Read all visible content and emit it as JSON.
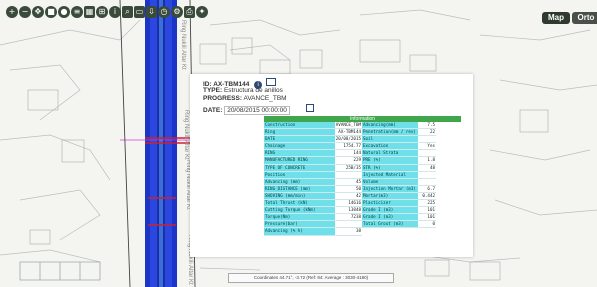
{
  "map": {
    "street_labels": [
      "Ring Nukili Altar Kt",
      "Ring Nukili Altar Kt",
      "Ring Nukili Altar Kt",
      "Ring Nukili Altar Kt"
    ],
    "toggles": {
      "map": "Map",
      "orto": "Orto"
    },
    "colors": {
      "accent": "#2d3a2d",
      "track_blue": "#1b35c7",
      "track_red": "#cc2233",
      "info_green": "#3fa64b",
      "label_cyan": "#6fe0ea"
    }
  },
  "toolbar": {
    "icons": [
      "zoom-in-icon",
      "zoom-out-icon",
      "pan-icon",
      "stop-icon",
      "record-icon",
      "layers-icon",
      "grid-icon",
      "measure-icon",
      "info-icon",
      "search-icon",
      "select-icon",
      "export-icon",
      "clock-icon",
      "settings-icon",
      "print-icon",
      "marker-icon"
    ]
  },
  "popup": {
    "id": "ID: AX-TBM144",
    "type_label": "TYPE:",
    "type_value": "Estructura de anillos",
    "progress_label": "PROGRESS:",
    "progress_value": "AVANCE_TBM",
    "date_label": "DATE:",
    "date_value": "20/08/2015 00:00:00",
    "info_title": "Information",
    "left_rows": [
      {
        "k": "Construction",
        "v": "AVANCE_TBM"
      },
      {
        "k": "Ring",
        "v": "AX-TBM144"
      },
      {
        "k": "DATE",
        "v": "20/08/2015"
      },
      {
        "k": "Chainage",
        "v": "1754.77"
      },
      {
        "k": "RING",
        "v": "144"
      },
      {
        "k": "MANUFACTURED RING",
        "v": "229"
      },
      {
        "k": "TYPE OF CONCRETE",
        "v": "25B/35"
      },
      {
        "k": "Position",
        "v": ""
      },
      {
        "k": "Advancing (mm)",
        "v": "45"
      },
      {
        "k": "RING DISTANCE (mm)",
        "v": "50"
      },
      {
        "k": "SHOVING (mm/min)",
        "v": "42"
      },
      {
        "k": "Total Thrust (kN)",
        "v": "14616"
      },
      {
        "k": "Cutting Torque (kNm)",
        "v": "13848"
      },
      {
        "k": "Torque(Nm)",
        "v": "7238"
      },
      {
        "k": "Pressure(bar)",
        "v": ""
      },
      {
        "k": "Advancing (% h)",
        "v": "38"
      }
    ],
    "right_rows": [
      {
        "k": "Advancing(mm)",
        "v": "7.5"
      },
      {
        "k": "Penetration(mm / rev)",
        "v": "22"
      },
      {
        "k": "Soil",
        "v": ""
      },
      {
        "k": "Excavation",
        "v": "Yes"
      },
      {
        "k": "Natural Strata",
        "v": ""
      },
      {
        "k": "PRE (%)",
        "v": "1.8"
      },
      {
        "k": "STR (%)",
        "v": "48"
      },
      {
        "k": "Injected Material",
        "v": ""
      },
      {
        "k": "Volume",
        "v": ""
      },
      {
        "k": "Injection Mortar (m3)",
        "v": "6.7"
      },
      {
        "k": "Mortar(m3)",
        "v": "0.442"
      },
      {
        "k": "Plasticizer",
        "v": "225"
      },
      {
        "k": "Grade I (m3)",
        "v": "101"
      },
      {
        "k": "Grade I (m3)",
        "v": "101"
      },
      {
        "k": "Total Grout (m3)",
        "v": "0"
      }
    ]
  },
  "status": {
    "coordinates": "Coordinates 44.71°, -3.72 (Ref: 84: Average : 3030-4180)"
  }
}
